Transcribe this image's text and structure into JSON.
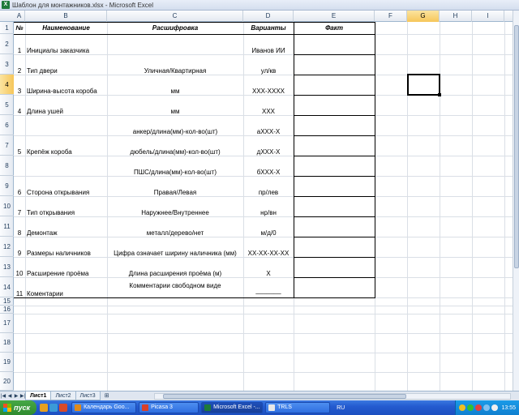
{
  "window": {
    "title": "Шаблон для монтажников.xlsx - Microsoft Excel",
    "app_icon": "excel-icon"
  },
  "sheet": {
    "columns": [
      "A",
      "B",
      "C",
      "D",
      "E",
      "F",
      "G",
      "H",
      "I"
    ],
    "selected_column": "G",
    "rows": [
      "1",
      "2",
      "3",
      "4",
      "5",
      "6",
      "7",
      "8",
      "9",
      "10",
      "11",
      "12",
      "13",
      "14",
      "15",
      "16",
      "17",
      "18",
      "19",
      "20"
    ],
    "selected_row": "4",
    "header": {
      "num": "№",
      "name": "Наименование",
      "decode": "Расшифровка",
      "variants": "Варианты",
      "fact": "Факт"
    },
    "items": [
      {
        "n": "1",
        "name": "Инициалы заказчика",
        "decode": "",
        "variant": "Иванов ИИ"
      },
      {
        "n": "2",
        "name": "Тип двери",
        "decode": "Уличная/Квартирная",
        "variant": "ул/кв"
      },
      {
        "n": "3",
        "name": "Ширина-высота короба",
        "decode": "мм",
        "variant": "XXX-XXXX"
      },
      {
        "n": "4",
        "name": "Длина ушей",
        "decode": "мм",
        "variant": "XXX"
      },
      {
        "n": "5",
        "name": "Крепёж короба",
        "decode": "",
        "variant": ""
      },
      {
        "n": "6",
        "name": "Сторона открывания",
        "decode": "Правая/Левая",
        "variant": "пр/лев"
      },
      {
        "n": "7",
        "name": "Тип открывания",
        "decode": "Наружнее/Внутреннее",
        "variant": "нр/вн"
      },
      {
        "n": "8",
        "name": "Демонтаж",
        "decode": "металл/дерево/нет",
        "variant": "м/д/0"
      },
      {
        "n": "9",
        "name": "Размеры  наличников",
        "decode": "Цифра означает ширину наличника (мм)",
        "variant": "XX-XX-XX-XX"
      },
      {
        "n": "10",
        "name": "Расширение проёма",
        "decode": "Длина расширения проёма (м)",
        "variant": "X"
      },
      {
        "n": "11",
        "name": "Коментарии",
        "decode": "Комментарии  свободном виде",
        "variant": "_______"
      }
    ],
    "fastening": [
      {
        "decode": "анкер/длина(мм)-кол-во(шт)",
        "variant": "аXXX-X"
      },
      {
        "decode": "дюбель/длина(мм)-кол-во(шт)",
        "variant": "дXXX-X"
      },
      {
        "decode": "ПШС/длина(мм)-кол-во(шт)",
        "variant": "бXXX-X"
      }
    ]
  },
  "tabs": {
    "sheet1": "Лист1",
    "sheet2": "Лист2",
    "sheet3": "Лист3"
  },
  "taskbar": {
    "start": "пуск",
    "buttons": [
      {
        "label": "Календарь Goo...",
        "color": "#e08a1a"
      },
      {
        "label": "Picasa 3",
        "color": "#d8402a"
      },
      {
        "label": "Microsoft Excel -...",
        "color": "#1d7a3a"
      },
      {
        "label": "TRLS",
        "color": "#e8e8e8"
      }
    ],
    "lang": "RU",
    "clock": "13:55"
  }
}
